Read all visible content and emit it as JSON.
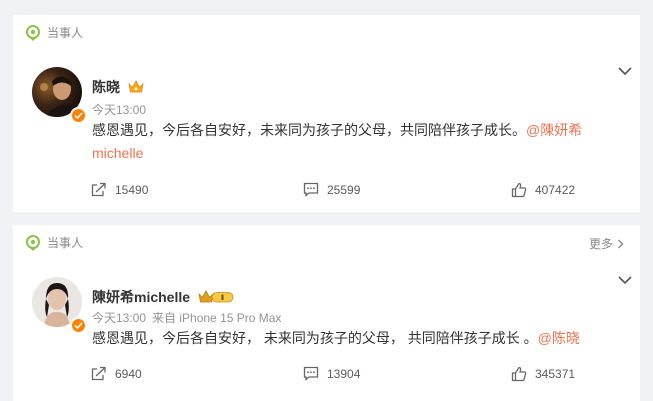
{
  "feed": {
    "posts": [
      {
        "section_label": "当事人",
        "more_label": "",
        "author": "陈晓",
        "time": "今天13:00",
        "source": "",
        "text": "感恩遇见，今后各自安好，未来同为孩子的父母，共同陪伴孩子成长。",
        "mention_line1": "@陳妍希",
        "mention_line2": "michelle",
        "shares": "15490",
        "comments": "25599",
        "likes": "407422"
      },
      {
        "section_label": "当事人",
        "more_label": "更多",
        "author": "陳妍希michelle",
        "time": "今天13:00",
        "source": "来自 iPhone 15 Pro Max",
        "text": "感恩遇见，今后各自安好， 未来同为孩子的父母， 共同陪伴孩子成长 。",
        "mention": "@陈晓",
        "shares": "6940",
        "comments": "13904",
        "likes": "345371"
      }
    ]
  },
  "colors": {
    "background": "#f1f2f5",
    "mention": "#eb7350",
    "verified_badge": "#ff8200",
    "section_icon": "#8bc34a"
  },
  "icons": {
    "section": "location-pin-icon",
    "crown": "crown-badge-icon",
    "share": "share-icon",
    "comment": "comment-icon",
    "like": "thumbs-up-icon",
    "menu": "chevron-down-icon"
  }
}
